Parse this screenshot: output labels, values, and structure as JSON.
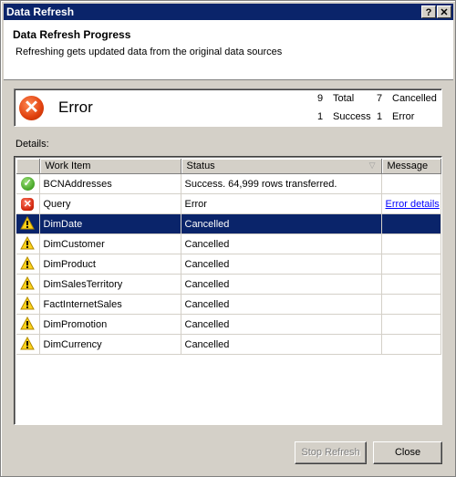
{
  "window": {
    "title": "Data Refresh",
    "help_label": "?",
    "close_label": "✕"
  },
  "header": {
    "title": "Data Refresh Progress",
    "subtitle": "Refreshing gets updated data from the original data sources"
  },
  "summary": {
    "state": "Error",
    "state_icon": "error-icon",
    "stats": {
      "total": {
        "count": "9",
        "label": "Total"
      },
      "cancelled": {
        "count": "7",
        "label": "Cancelled"
      },
      "success": {
        "count": "1",
        "label": "Success"
      },
      "error": {
        "count": "1",
        "label": "Error"
      }
    }
  },
  "details": {
    "label": "Details:",
    "columns": [
      "",
      "Work Item",
      "Status",
      "Message"
    ],
    "sort_indicator": "▽",
    "rows": [
      {
        "icon": "success",
        "work_item": "BCNAddresses",
        "status": "Success. 64,999 rows transferred.",
        "message": ""
      },
      {
        "icon": "error",
        "work_item": "Query",
        "status": "Error",
        "message": "Error details"
      },
      {
        "icon": "warning",
        "work_item": "DimDate",
        "status": "Cancelled",
        "message": "",
        "selected": true
      },
      {
        "icon": "warning",
        "work_item": "DimCustomer",
        "status": "Cancelled",
        "message": ""
      },
      {
        "icon": "warning",
        "work_item": "DimProduct",
        "status": "Cancelled",
        "message": ""
      },
      {
        "icon": "warning",
        "work_item": "DimSalesTerritory",
        "status": "Cancelled",
        "message": ""
      },
      {
        "icon": "warning",
        "work_item": "FactInternetSales",
        "status": "Cancelled",
        "message": ""
      },
      {
        "icon": "warning",
        "work_item": "DimPromotion",
        "status": "Cancelled",
        "message": ""
      },
      {
        "icon": "warning",
        "work_item": "DimCurrency",
        "status": "Cancelled",
        "message": ""
      }
    ]
  },
  "buttons": {
    "stop_refresh": "Stop Refresh",
    "close": "Close"
  },
  "colors": {
    "titlebar": "#0a246a",
    "selection": "#0a246a",
    "link": "#0000ff"
  }
}
